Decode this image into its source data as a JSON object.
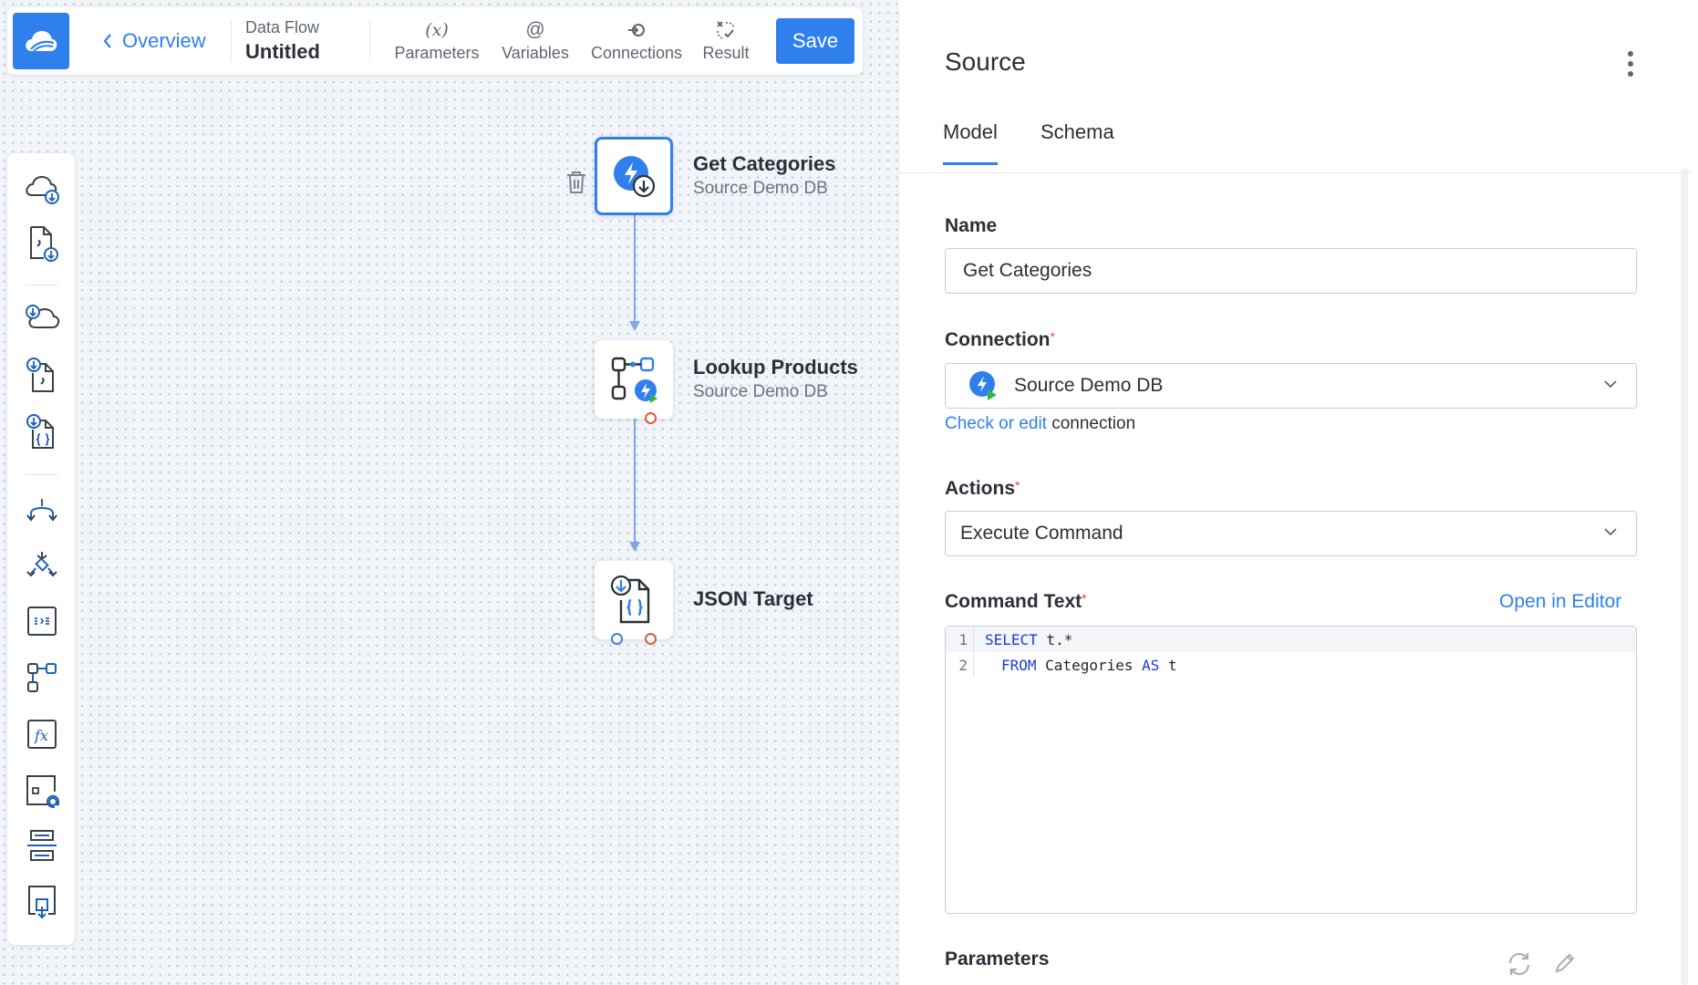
{
  "toolbar": {
    "back_label": "Overview",
    "flow_type": "Data Flow",
    "flow_name": "Untitled",
    "buttons": [
      {
        "label": "Parameters",
        "icon": "x-variable-icon"
      },
      {
        "label": "Variables",
        "icon": "at-icon"
      },
      {
        "label": "Connections",
        "icon": "connection-icon"
      },
      {
        "label": "Result",
        "icon": "result-icon"
      }
    ],
    "param_symbol": "(x)",
    "at_symbol": "@",
    "save_label": "Save"
  },
  "palette": {
    "items": [
      "cloud-source-icon",
      "file-source-icon",
      "cloud-target-icon",
      "file-target-icon",
      "json-target-icon",
      "split-icon",
      "merge-icon",
      "map-icon",
      "lookup-icon",
      "function-icon",
      "variable-icon",
      "table-icon",
      "extend-icon"
    ],
    "fx_label": "fx"
  },
  "nodes": [
    {
      "title": "Get Categories",
      "subtitle": "Source Demo DB",
      "icon": "source-db-icon",
      "selected": true
    },
    {
      "title": "Lookup Products",
      "subtitle": "Source Demo DB",
      "icon": "lookup-icon"
    },
    {
      "title": "JSON Target",
      "subtitle": "",
      "icon": "json-file-icon"
    }
  ],
  "panel": {
    "title": "Source",
    "tabs": [
      {
        "label": "Model",
        "active": true
      },
      {
        "label": "Schema",
        "active": false
      }
    ],
    "name_label": "Name",
    "name_value": "Get Categories",
    "connection_label": "Connection",
    "connection_value": "Source Demo DB",
    "check_link": "Check or edit",
    "check_suffix": "connection",
    "actions_label": "Actions",
    "actions_value": "Execute Command",
    "command_label": "Command Text",
    "open_editor": "Open in Editor",
    "required_mark": "*",
    "code_lines": [
      {
        "num": "1",
        "kw": "SELECT",
        "rest": " t.*"
      },
      {
        "num": "2",
        "kw": "FROM",
        "rest": " Categories ",
        "kw2": "AS",
        "rest2": " t"
      }
    ],
    "parameters_label": "Parameters"
  },
  "colors": {
    "accent": "#2f80ed",
    "canvas_bg": "#f1f4f9",
    "required": "#e0473c",
    "port_out": "#e05a3c",
    "port_in": "#3c83d9"
  }
}
